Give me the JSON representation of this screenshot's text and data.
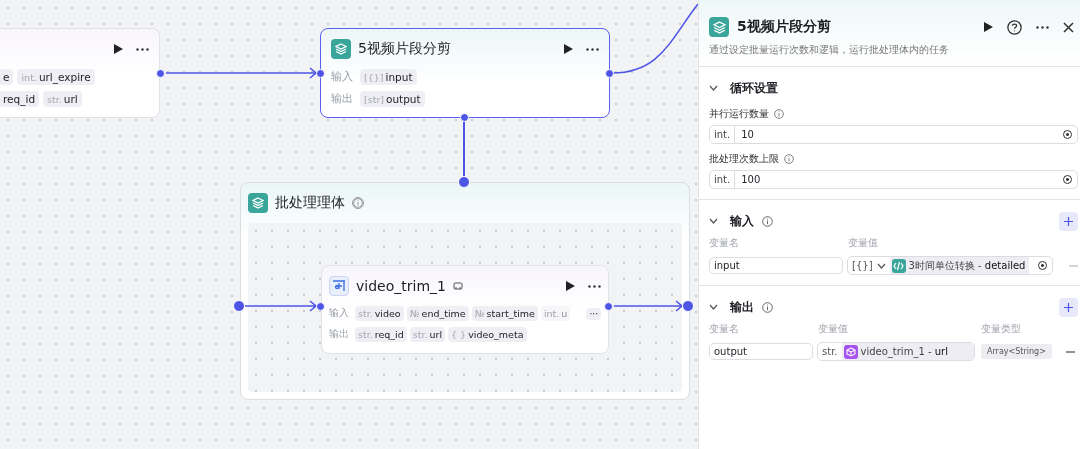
{
  "canvas": {
    "left_node": {
      "rows": [
        [
          {
            "name": "e"
          },
          {
            "type": "int.",
            "name": "url_expire"
          }
        ],
        [
          {
            "name": "req_id"
          },
          {
            "type": "str.",
            "name": "url"
          }
        ]
      ]
    },
    "loop_node": {
      "title": "5视频片段分剪",
      "selected": true,
      "rows": [
        {
          "label": "输入",
          "tags": [
            {
              "type": "[{}]",
              "name": "input"
            }
          ]
        },
        {
          "label": "输出",
          "tags": [
            {
              "type": "[str]",
              "name": "output"
            }
          ]
        }
      ]
    },
    "batch": {
      "title": "批处理理体",
      "node": {
        "title": "video_trim_1",
        "rows": [
          {
            "label": "输入",
            "tags": [
              {
                "type": "str.",
                "name": "video"
              },
              {
                "type": "№",
                "name": "end_time"
              },
              {
                "type": "№",
                "name": "start_time"
              },
              {
                "type": "int.",
                "name": "u",
                "faded": true
              }
            ],
            "more": "···"
          },
          {
            "label": "输出",
            "tags": [
              {
                "type": "str.",
                "name": "req_id"
              },
              {
                "type": "str.",
                "name": "url"
              },
              {
                "type": "{ }",
                "name": "video_meta"
              }
            ]
          }
        ]
      }
    }
  },
  "panel": {
    "title": "5视频片段分剪",
    "description": "通过设定批量运行次数和逻辑，运行批处理体内的任务",
    "loop_settings": {
      "title": "循环设置",
      "expanded": true,
      "fields": [
        {
          "label": "并行运行数量",
          "type": "int.",
          "value": "10"
        },
        {
          "label": "批处理次数上限",
          "type": "int.",
          "value": "100"
        }
      ]
    },
    "inputs": {
      "title": "输入",
      "expanded": true,
      "columns": [
        "变量名",
        "变量值"
      ],
      "rows": [
        {
          "name": "input",
          "type": "[{}]",
          "ref": "3时间单位转换 - **detailed**"
        }
      ]
    },
    "outputs": {
      "title": "输出",
      "expanded": true,
      "columns": [
        "变量名",
        "变量值",
        "变量类型"
      ],
      "rows": [
        {
          "name": "output",
          "type": "str.",
          "ref": "video_trim_1 - **url**",
          "var_type": "Array<String>"
        }
      ]
    }
  }
}
